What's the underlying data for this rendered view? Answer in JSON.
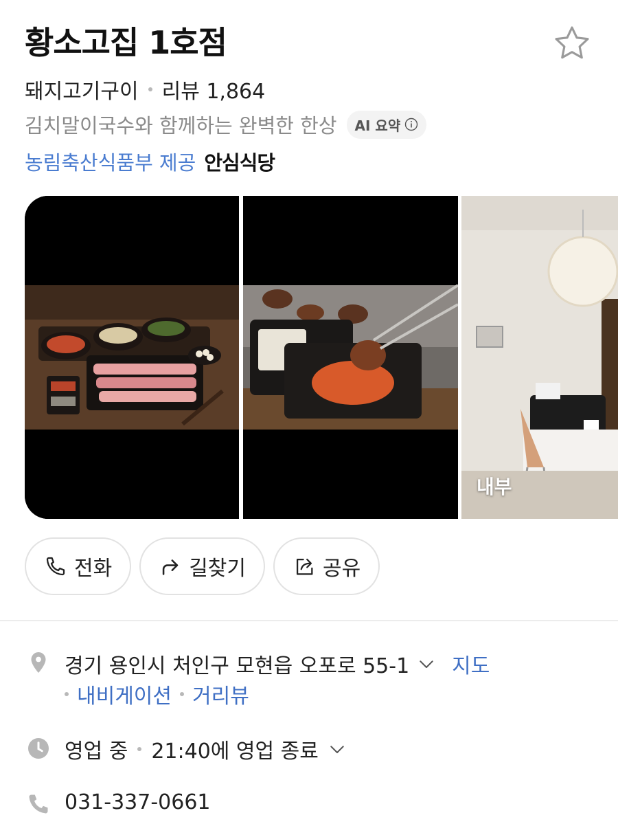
{
  "place": {
    "name": "황소고집 1호점",
    "category": "돼지고기구이",
    "review_label": "리뷰 1,864",
    "summary": "김치말이국수와 함께하는 완벽한 한상",
    "ai_badge": "AI 요약",
    "cert_provider": "농림축산식품부 제공",
    "cert_badge": "안심식당"
  },
  "photos": [
    {
      "name": "food-set-photo",
      "label": ""
    },
    {
      "name": "grill-photo",
      "label": ""
    },
    {
      "name": "interior-photo",
      "label": "내부"
    }
  ],
  "actions": {
    "call": "전화",
    "directions": "길찾기",
    "share": "공유"
  },
  "address": {
    "text": "경기 용인시 처인구 모현읍 오포로 55-1",
    "map_link": "지도",
    "navi_link": "내비게이션",
    "street_link": "거리뷰"
  },
  "hours": {
    "status": "영업 중",
    "close": "21:40에 영업 종료"
  },
  "phone": "031-337-0661",
  "colors": {
    "link": "#3f6fc4",
    "provider": "#4a7cd0",
    "muted": "#8a8a8a"
  },
  "icons": [
    "star-icon",
    "info-icon",
    "phone-icon",
    "directions-icon",
    "share-icon",
    "location-pin-icon",
    "chevron-down-icon",
    "clock-icon"
  ]
}
